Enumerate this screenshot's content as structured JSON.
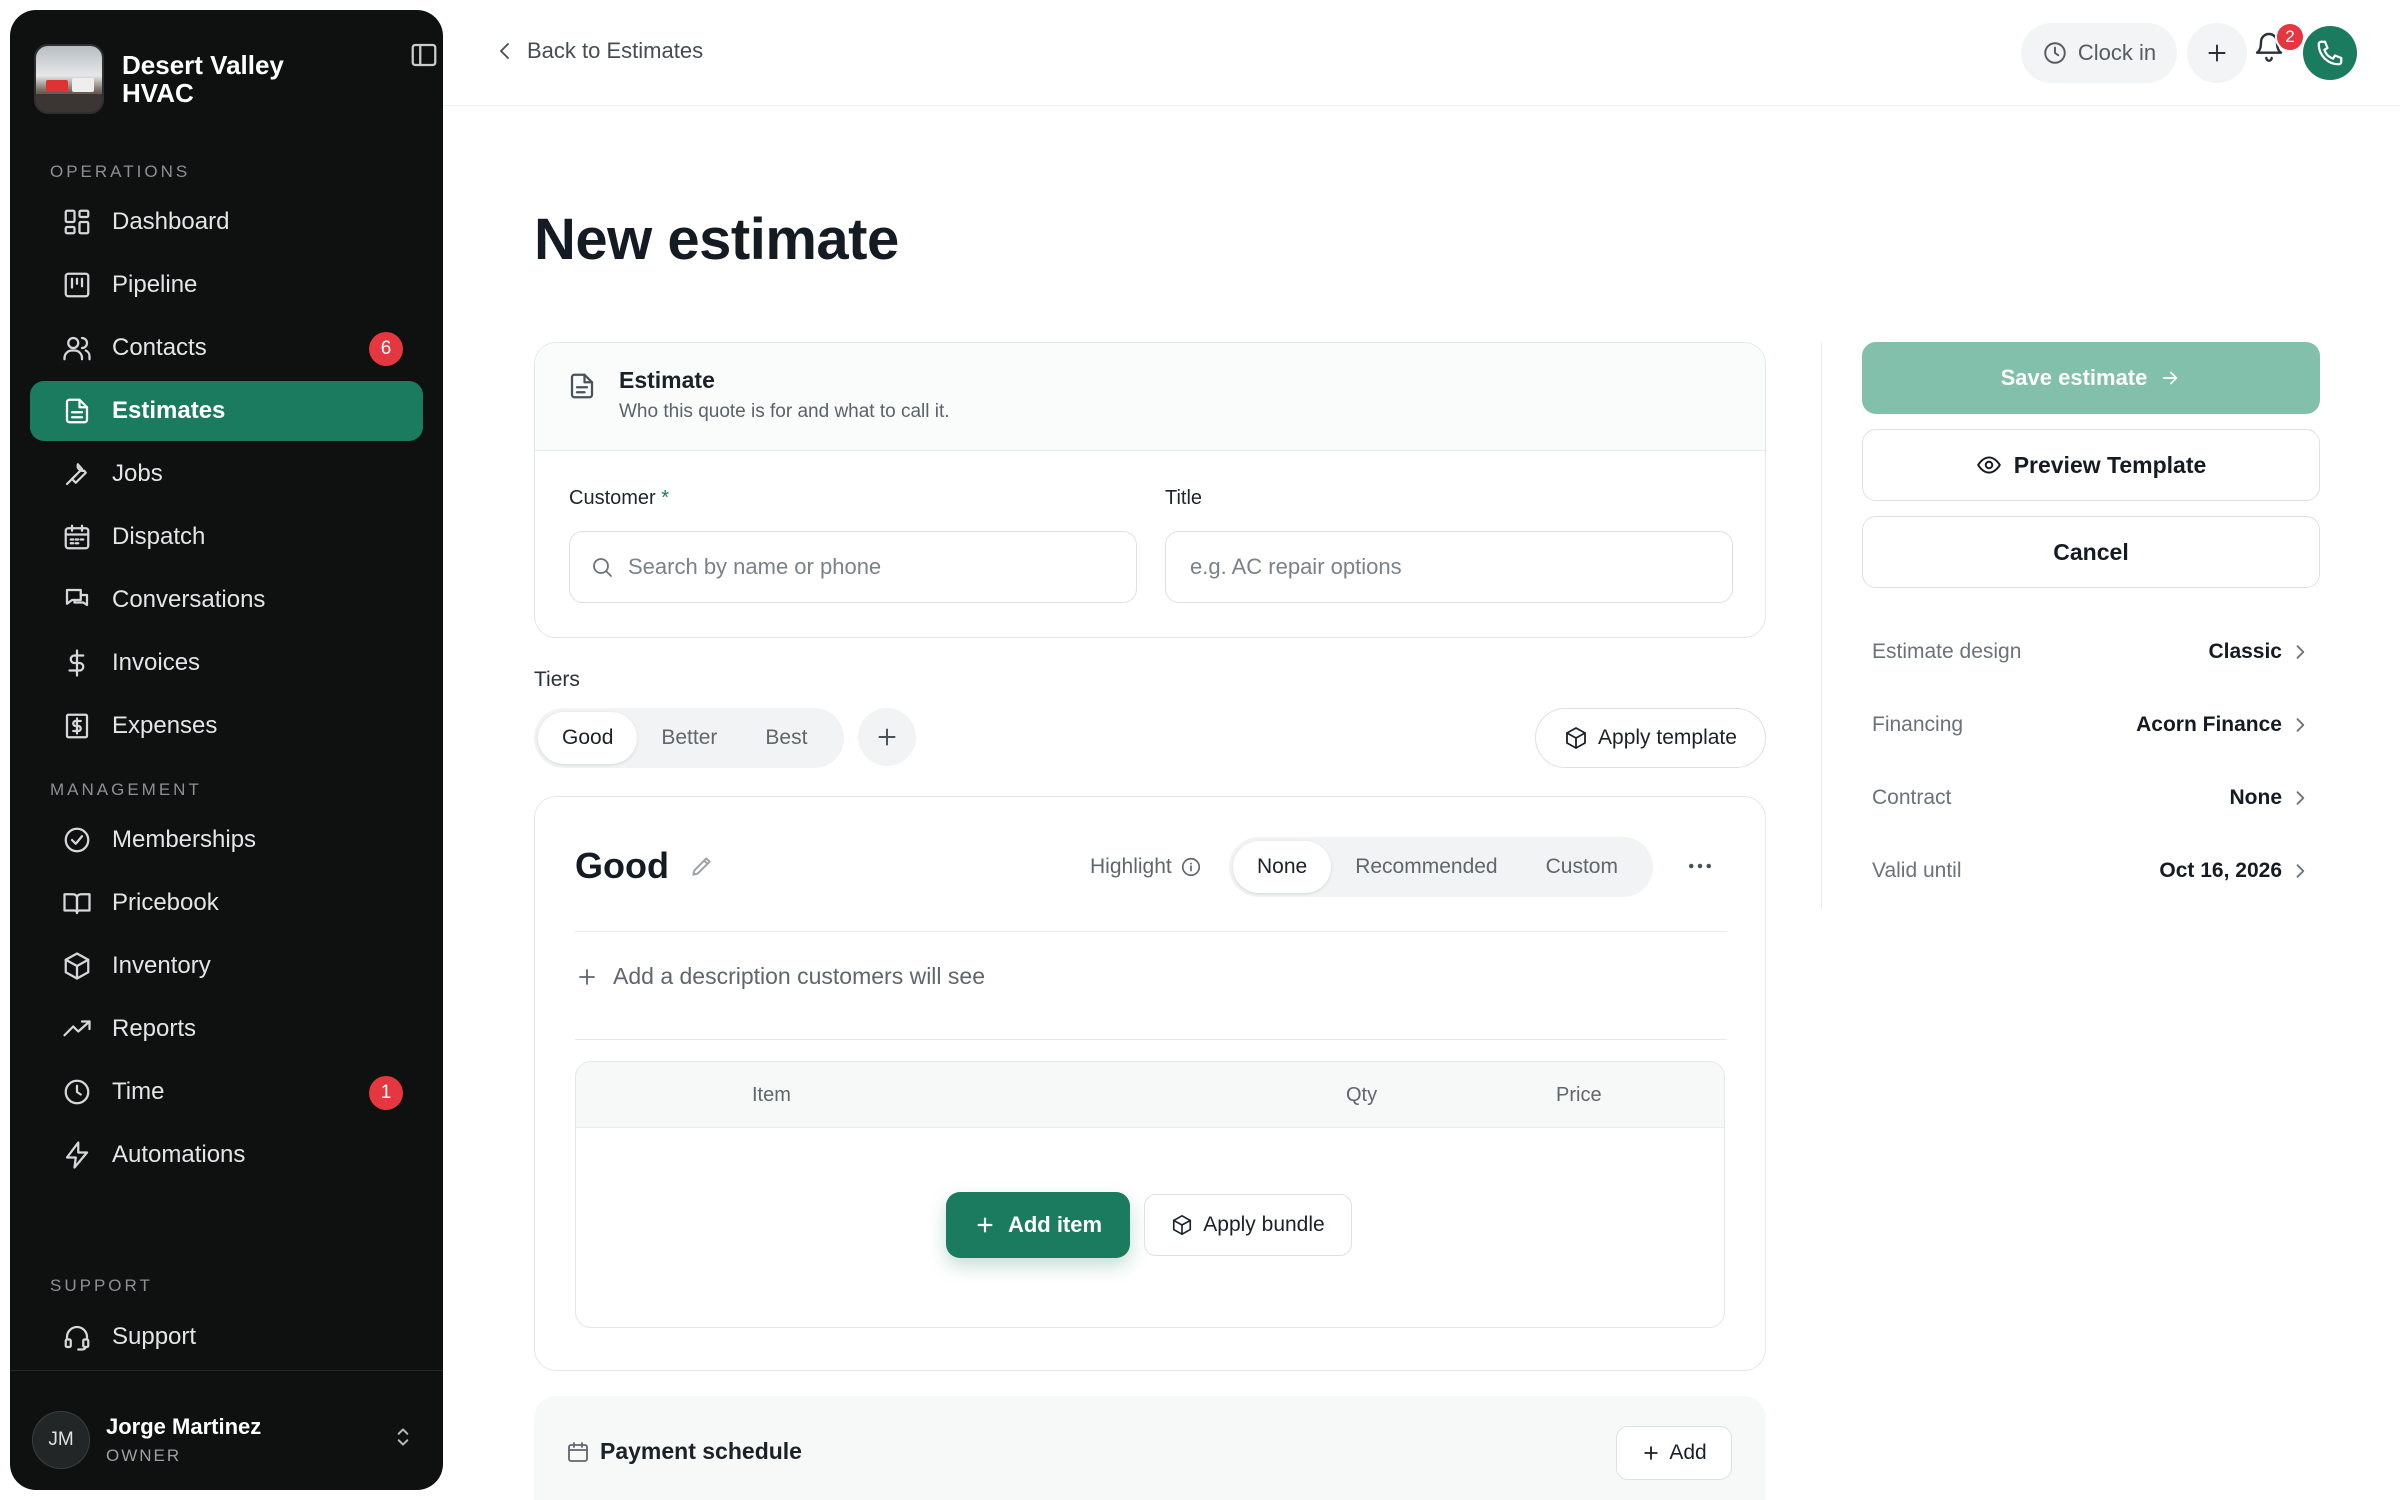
{
  "brand": {
    "name": "Desert Valley HVAC"
  },
  "sidebar": {
    "sections": {
      "operations": "OPERATIONS",
      "management": "MANAGEMENT",
      "support": "SUPPORT"
    },
    "items": [
      {
        "label": "Dashboard",
        "icon": "dashboard-icon"
      },
      {
        "label": "Pipeline",
        "icon": "pipeline-icon"
      },
      {
        "label": "Contacts",
        "icon": "contacts-icon",
        "badge": "6"
      },
      {
        "label": "Estimates",
        "icon": "estimates-icon",
        "active": true
      },
      {
        "label": "Jobs",
        "icon": "wrench-icon"
      },
      {
        "label": "Dispatch",
        "icon": "calendar-icon"
      },
      {
        "label": "Conversations",
        "icon": "chat-icon"
      },
      {
        "label": "Invoices",
        "icon": "dollar-icon"
      },
      {
        "label": "Expenses",
        "icon": "receipt-icon"
      },
      {
        "label": "Memberships",
        "icon": "check-circle-icon"
      },
      {
        "label": "Pricebook",
        "icon": "book-icon"
      },
      {
        "label": "Inventory",
        "icon": "box-icon"
      },
      {
        "label": "Reports",
        "icon": "trend-icon"
      },
      {
        "label": "Time",
        "icon": "clock-icon",
        "badge": "1"
      },
      {
        "label": "Automations",
        "icon": "bolt-icon"
      },
      {
        "label": "Support",
        "icon": "headset-icon"
      }
    ],
    "user": {
      "initials": "JM",
      "name": "Jorge Martinez",
      "role": "OWNER"
    }
  },
  "topbar": {
    "back_label": "Back to Estimates",
    "clock_in_label": "Clock in",
    "notifications_count": "2"
  },
  "main": {
    "title": "New estimate",
    "estimate_card": {
      "heading": "Estimate",
      "subheading": "Who this quote is for and what to call it.",
      "customer_label": "Customer",
      "customer_required": "*",
      "customer_placeholder": "Search by name or phone",
      "title_label": "Title",
      "title_placeholder": "e.g. AC repair options"
    },
    "tiers": {
      "label": "Tiers",
      "tabs": [
        "Good",
        "Better",
        "Best"
      ],
      "selected": "Good",
      "apply_template_label": "Apply template"
    },
    "tier_card": {
      "title": "Good",
      "highlight_label": "Highlight",
      "highlight_options": [
        "None",
        "Recommended",
        "Custom"
      ],
      "highlight_selected": "None",
      "add_description_label": "Add a description customers will see",
      "columns": {
        "item": "Item",
        "qty": "Qty",
        "price": "Price"
      },
      "add_item_label": "Add item",
      "apply_bundle_label": "Apply bundle"
    },
    "payment_schedule": {
      "heading": "Payment schedule",
      "add_label": "Add"
    }
  },
  "right_panel": {
    "save_label": "Save estimate",
    "preview_label": "Preview Template",
    "cancel_label": "Cancel",
    "meta": [
      {
        "key": "Estimate design",
        "value": "Classic"
      },
      {
        "key": "Financing",
        "value": "Acorn Finance"
      },
      {
        "key": "Contract",
        "value": "None"
      },
      {
        "key": "Valid until",
        "value": "Oct 16, 2026"
      }
    ]
  },
  "colors": {
    "accent": "#1b7b5e",
    "accent_disabled": "#82c0ab",
    "sidebar_bg": "#0f1111",
    "badge": "#e5373f"
  }
}
